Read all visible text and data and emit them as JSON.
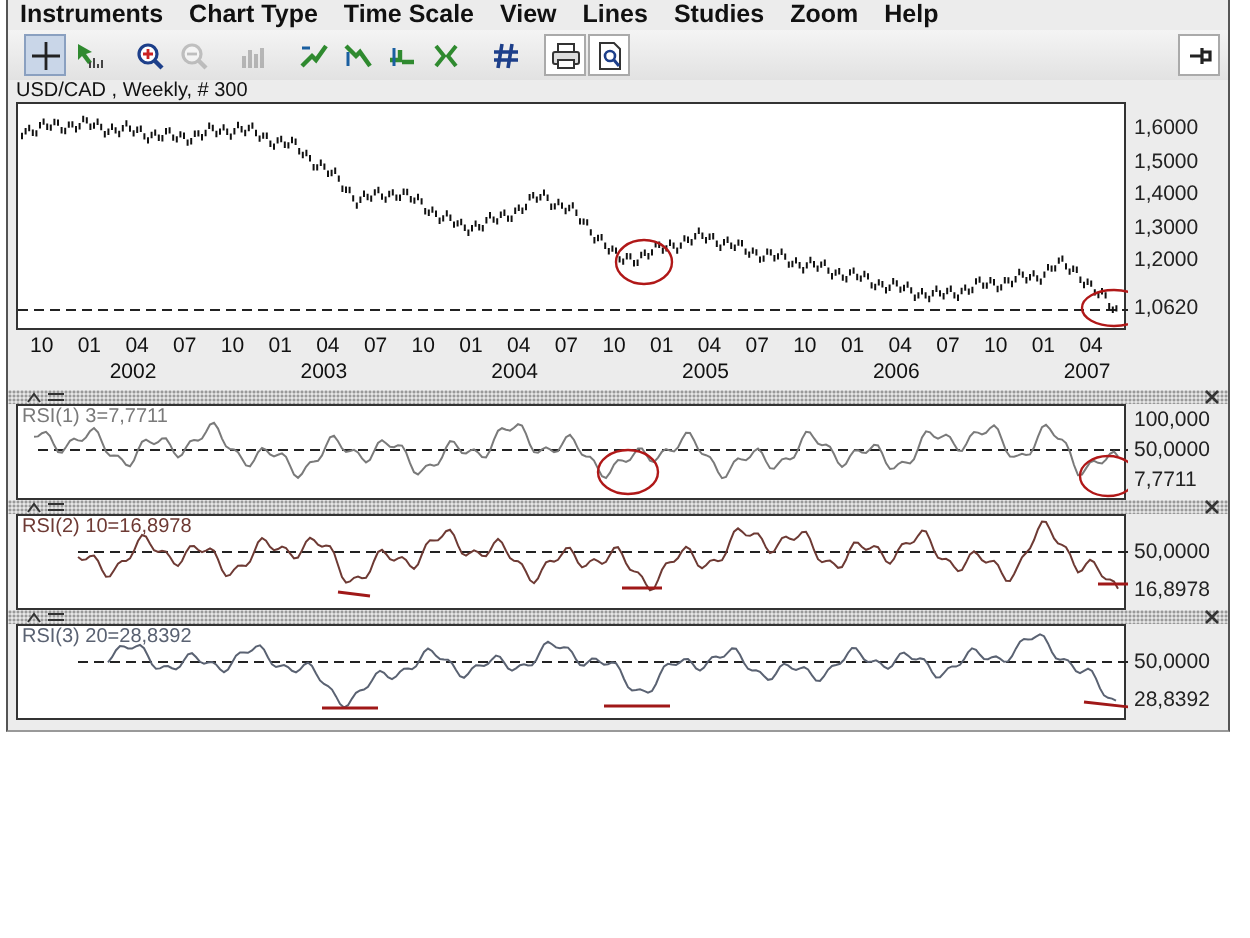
{
  "menu": [
    "Instruments",
    "Chart Type",
    "Time Scale",
    "View",
    "Lines",
    "Studies",
    "Zoom",
    "Help"
  ],
  "toolbar": [
    {
      "kind": "crosshair",
      "selected": true,
      "disabled": false
    },
    {
      "kind": "cursor",
      "selected": false,
      "disabled": false
    },
    {
      "kind": "separator"
    },
    {
      "kind": "zoom-in",
      "selected": false,
      "disabled": false
    },
    {
      "kind": "zoom-out",
      "selected": false,
      "disabled": true
    },
    {
      "kind": "separator"
    },
    {
      "kind": "bars",
      "selected": false,
      "disabled": true
    },
    {
      "kind": "separator"
    },
    {
      "kind": "trend-up",
      "selected": false,
      "disabled": false
    },
    {
      "kind": "trend-down",
      "selected": false,
      "disabled": false
    },
    {
      "kind": "trend-flat",
      "selected": false,
      "disabled": false
    },
    {
      "kind": "trend-reverse",
      "selected": false,
      "disabled": false
    },
    {
      "kind": "separator"
    },
    {
      "kind": "grid",
      "selected": false,
      "disabled": false
    },
    {
      "kind": "separator"
    },
    {
      "kind": "print",
      "selected": false,
      "disabled": false
    },
    {
      "kind": "preview",
      "selected": false,
      "disabled": false
    },
    {
      "kind": "spacer"
    },
    {
      "kind": "pin",
      "selected": false,
      "disabled": false
    }
  ],
  "chart": {
    "title": "USD/CAD , Weekly, # 300",
    "price_labels": [
      "1,6000",
      "1,5000",
      "1,4000",
      "1,3000",
      "1,2000"
    ],
    "current_price": "1,0620",
    "time_ticks": [
      {
        "label": "10"
      },
      {
        "label": "01",
        "year": "2002"
      },
      {
        "label": "04"
      },
      {
        "label": "07"
      },
      {
        "label": "10"
      },
      {
        "label": "01",
        "year": "2003"
      },
      {
        "label": "04"
      },
      {
        "label": "07"
      },
      {
        "label": "10"
      },
      {
        "label": "01",
        "year": "2004"
      },
      {
        "label": "04"
      },
      {
        "label": "07"
      },
      {
        "label": "10"
      },
      {
        "label": "01",
        "year": "2005"
      },
      {
        "label": "04"
      },
      {
        "label": "07"
      },
      {
        "label": "10"
      },
      {
        "label": "01",
        "year": "2006"
      },
      {
        "label": "04"
      },
      {
        "label": "07"
      },
      {
        "label": "10"
      },
      {
        "label": "01",
        "year": "2007"
      },
      {
        "label": "04"
      }
    ]
  },
  "indicators": [
    {
      "title": "RSI(1) 3=7,7711",
      "color": "#7a7a7a",
      "levels": [
        {
          "label": "100,000",
          "kind": "top"
        },
        {
          "label": "50,0000",
          "kind": "mid"
        }
      ],
      "current": "7,7711"
    },
    {
      "title": "RSI(2) 10=16,8978",
      "color": "#6e3a34",
      "levels": [
        {
          "label": "50,0000",
          "kind": "mid"
        }
      ],
      "current": "16,8978"
    },
    {
      "title": "RSI(3) 20=28,8392",
      "color": "#5a6272",
      "levels": [
        {
          "label": "50,0000",
          "kind": "mid"
        }
      ],
      "current": "28,8392"
    }
  ]
}
